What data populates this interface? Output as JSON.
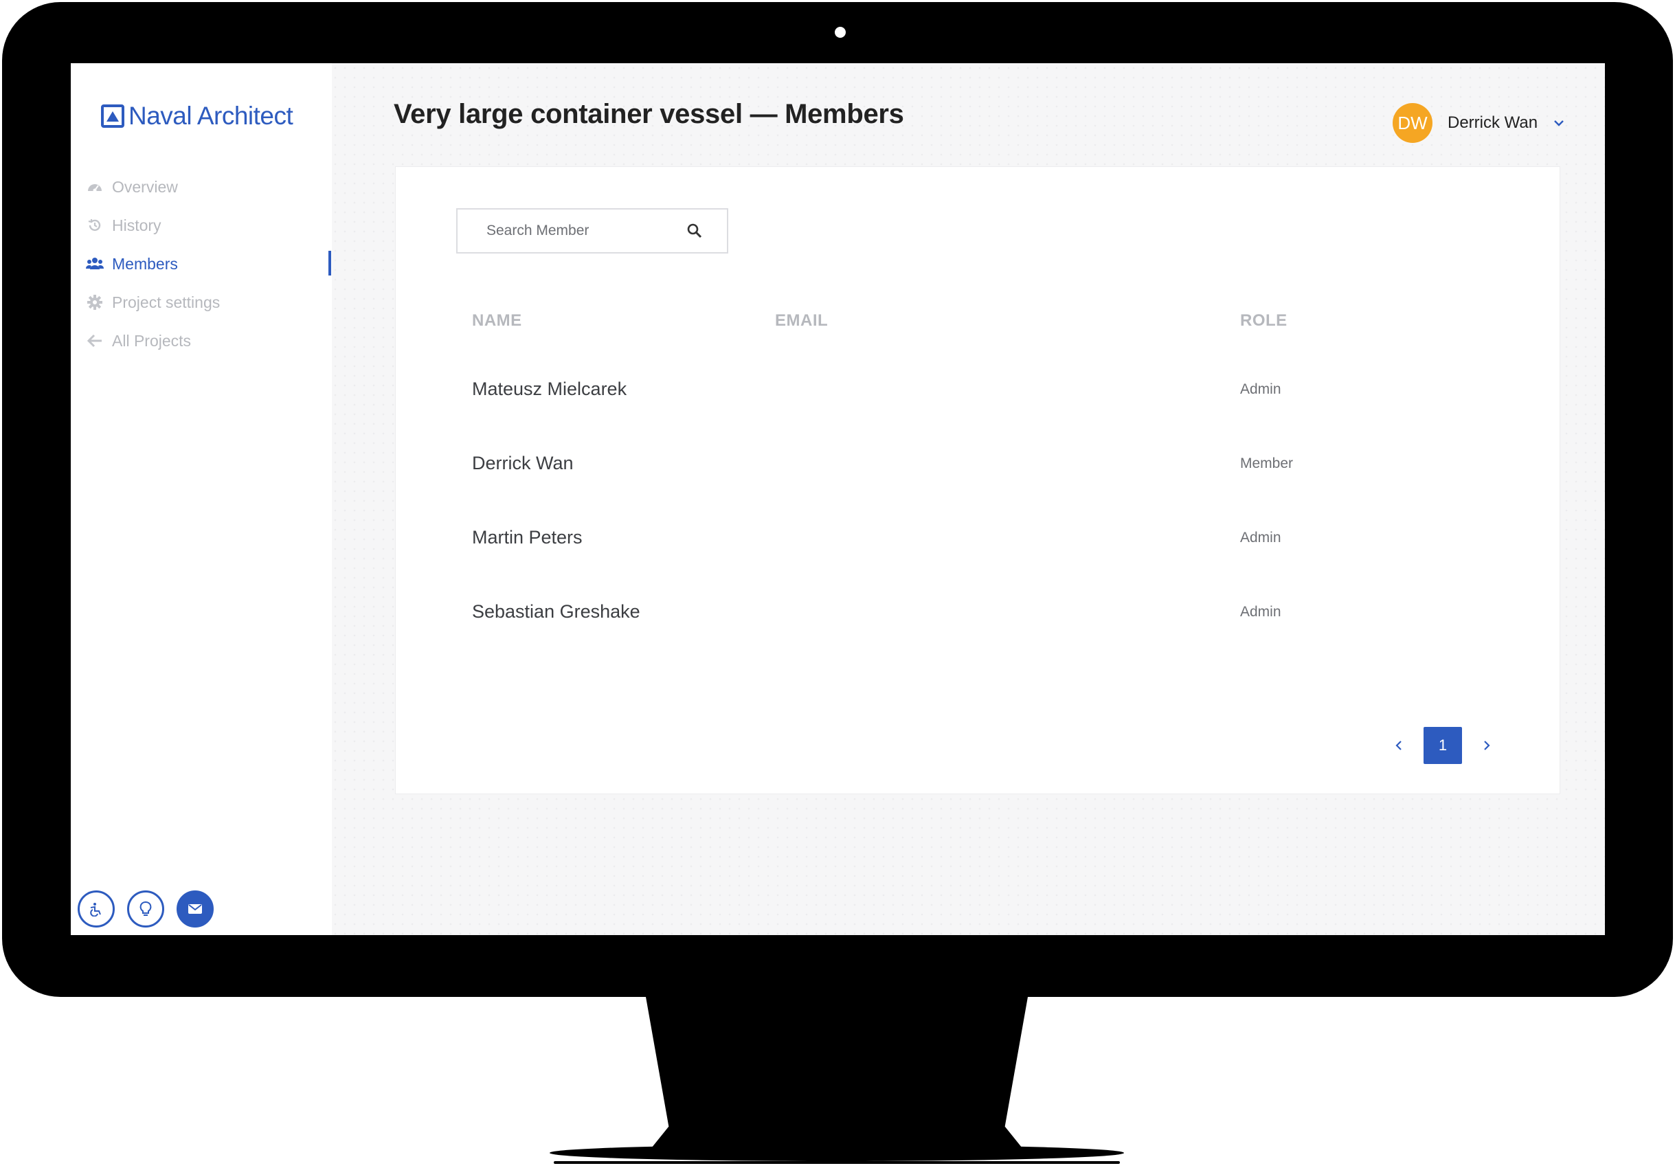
{
  "app": {
    "name": "Naval Architect"
  },
  "sidebar": {
    "items": [
      {
        "label": "Overview",
        "icon": "dashboard-icon",
        "active": false
      },
      {
        "label": "History",
        "icon": "history-icon",
        "active": false
      },
      {
        "label": "Members",
        "icon": "users-icon",
        "active": true
      },
      {
        "label": "Project settings",
        "icon": "gear-icon",
        "active": false
      },
      {
        "label": "All Projects",
        "icon": "arrow-left-icon",
        "active": false
      }
    ],
    "bottom_icons": [
      "accessibility-icon",
      "lightbulb-icon",
      "mail-icon"
    ]
  },
  "header": {
    "title": "Very large container vessel — Members",
    "user": {
      "initials": "DW",
      "name": "Derrick Wan"
    }
  },
  "search": {
    "placeholder": "Search Member",
    "value": ""
  },
  "table": {
    "columns": [
      "NAME",
      "EMAIL",
      "ROLE"
    ],
    "rows": [
      {
        "name": "Mateusz Mielcarek",
        "email": "",
        "role": "Admin"
      },
      {
        "name": "Derrick Wan",
        "email": "",
        "role": "Member"
      },
      {
        "name": "Martin Peters",
        "email": "",
        "role": "Admin"
      },
      {
        "name": "Sebastian Greshake",
        "email": "",
        "role": "Admin"
      }
    ]
  },
  "pagination": {
    "current": "1"
  },
  "colors": {
    "accent": "#2d5bbf",
    "avatar": "#f5a623",
    "muted": "#b6b8bd"
  }
}
